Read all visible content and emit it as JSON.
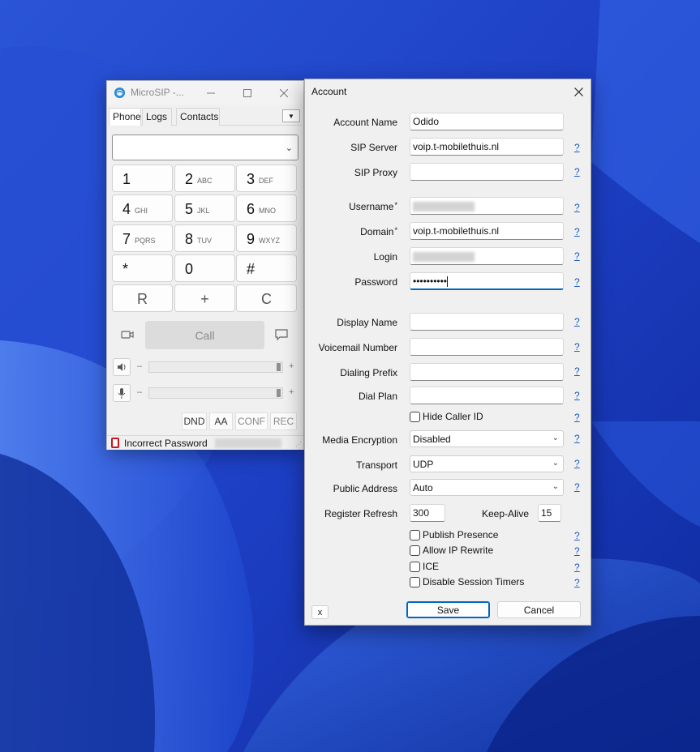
{
  "microsip": {
    "title": "MicroSIP -...",
    "tabs": [
      "Phone",
      "Logs",
      "Contacts"
    ],
    "keys": [
      {
        "digit": "1",
        "letters": ""
      },
      {
        "digit": "2",
        "letters": "ABC"
      },
      {
        "digit": "3",
        "letters": "DEF"
      },
      {
        "digit": "4",
        "letters": "GHI"
      },
      {
        "digit": "5",
        "letters": "JKL"
      },
      {
        "digit": "6",
        "letters": "MNO"
      },
      {
        "digit": "7",
        "letters": "PQRS"
      },
      {
        "digit": "8",
        "letters": "TUV"
      },
      {
        "digit": "9",
        "letters": "WXYZ"
      },
      {
        "digit": "*",
        "letters": ""
      },
      {
        "digit": "0",
        "letters": ""
      },
      {
        "digit": "#",
        "letters": ""
      }
    ],
    "func_keys": [
      "R",
      "+",
      "C"
    ],
    "call_label": "Call",
    "minus": "–",
    "plus": "+",
    "controls": [
      "DND",
      "AA",
      "CONF",
      "REC"
    ],
    "status_text": "Incorrect Password"
  },
  "account": {
    "title": "Account",
    "help": "?",
    "fields": {
      "account_name": {
        "label": "Account Name",
        "value": "Odido"
      },
      "sip_server": {
        "label": "SIP Server",
        "value": "voip.t-mobilethuis.nl"
      },
      "sip_proxy": {
        "label": "SIP Proxy",
        "value": ""
      },
      "username": {
        "label": "Username",
        "value": ""
      },
      "domain": {
        "label": "Domain",
        "value": "voip.t-mobilethuis.nl"
      },
      "login": {
        "label": "Login",
        "value": ""
      },
      "password": {
        "label": "Password",
        "value": "••••••••••"
      },
      "display_name": {
        "label": "Display Name",
        "value": ""
      },
      "voicemail": {
        "label": "Voicemail Number",
        "value": ""
      },
      "dialing_prefix": {
        "label": "Dialing Prefix",
        "value": ""
      },
      "dial_plan": {
        "label": "Dial Plan",
        "value": ""
      }
    },
    "required_mark": "*",
    "hide_caller_id": "Hide Caller ID",
    "media_encryption": {
      "label": "Media Encryption",
      "value": "Disabled"
    },
    "transport": {
      "label": "Transport",
      "value": "UDP"
    },
    "public_address": {
      "label": "Public Address",
      "value": "Auto"
    },
    "register_refresh": {
      "label": "Register Refresh",
      "value": "300"
    },
    "keep_alive": {
      "label": "Keep-Alive",
      "value": "15"
    },
    "checkboxes": [
      "Publish Presence",
      "Allow IP Rewrite",
      "ICE",
      "Disable Session Timers"
    ],
    "x_label": "x",
    "save_label": "Save",
    "cancel_label": "Cancel"
  }
}
